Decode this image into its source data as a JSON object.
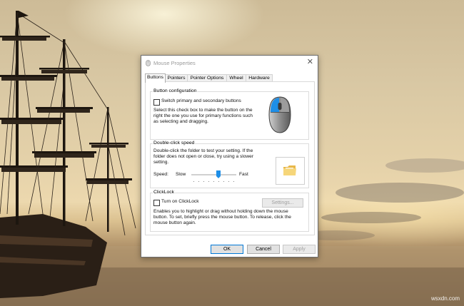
{
  "watermark": "wsxdn.com",
  "dialog": {
    "title": "Mouse Properties",
    "tabs": [
      {
        "label": "Buttons",
        "active": true
      },
      {
        "label": "Pointers",
        "active": false
      },
      {
        "label": "Pointer Options",
        "active": false
      },
      {
        "label": "Wheel",
        "active": false
      },
      {
        "label": "Hardware",
        "active": false
      }
    ],
    "button_configuration": {
      "label": "Button configuration",
      "switch_checkbox_label": "Switch primary and secondary buttons",
      "description": "Select this check box to make the button on the right the one you use for primary functions such as selecting and dragging."
    },
    "double_click": {
      "label": "Double-click speed",
      "description": "Double-click the folder to test your setting. If the folder does not open or close, try using a slower setting.",
      "speed_label": "Speed:",
      "slow_label": "Slow",
      "fast_label": "Fast",
      "speed_fraction": 0.6
    },
    "clicklock": {
      "label": "ClickLock",
      "checkbox_label": "Turn on ClickLock",
      "settings_label": "Settings...",
      "description": "Enables you to highlight or drag without holding down the mouse button. To set, briefly press the mouse button. To release, click the mouse button again."
    },
    "buttons": {
      "ok": "OK",
      "cancel": "Cancel",
      "apply": "Apply"
    },
    "colors": {
      "accent": "#1e8fe8",
      "mouse_body": "#6b6b6b"
    }
  }
}
